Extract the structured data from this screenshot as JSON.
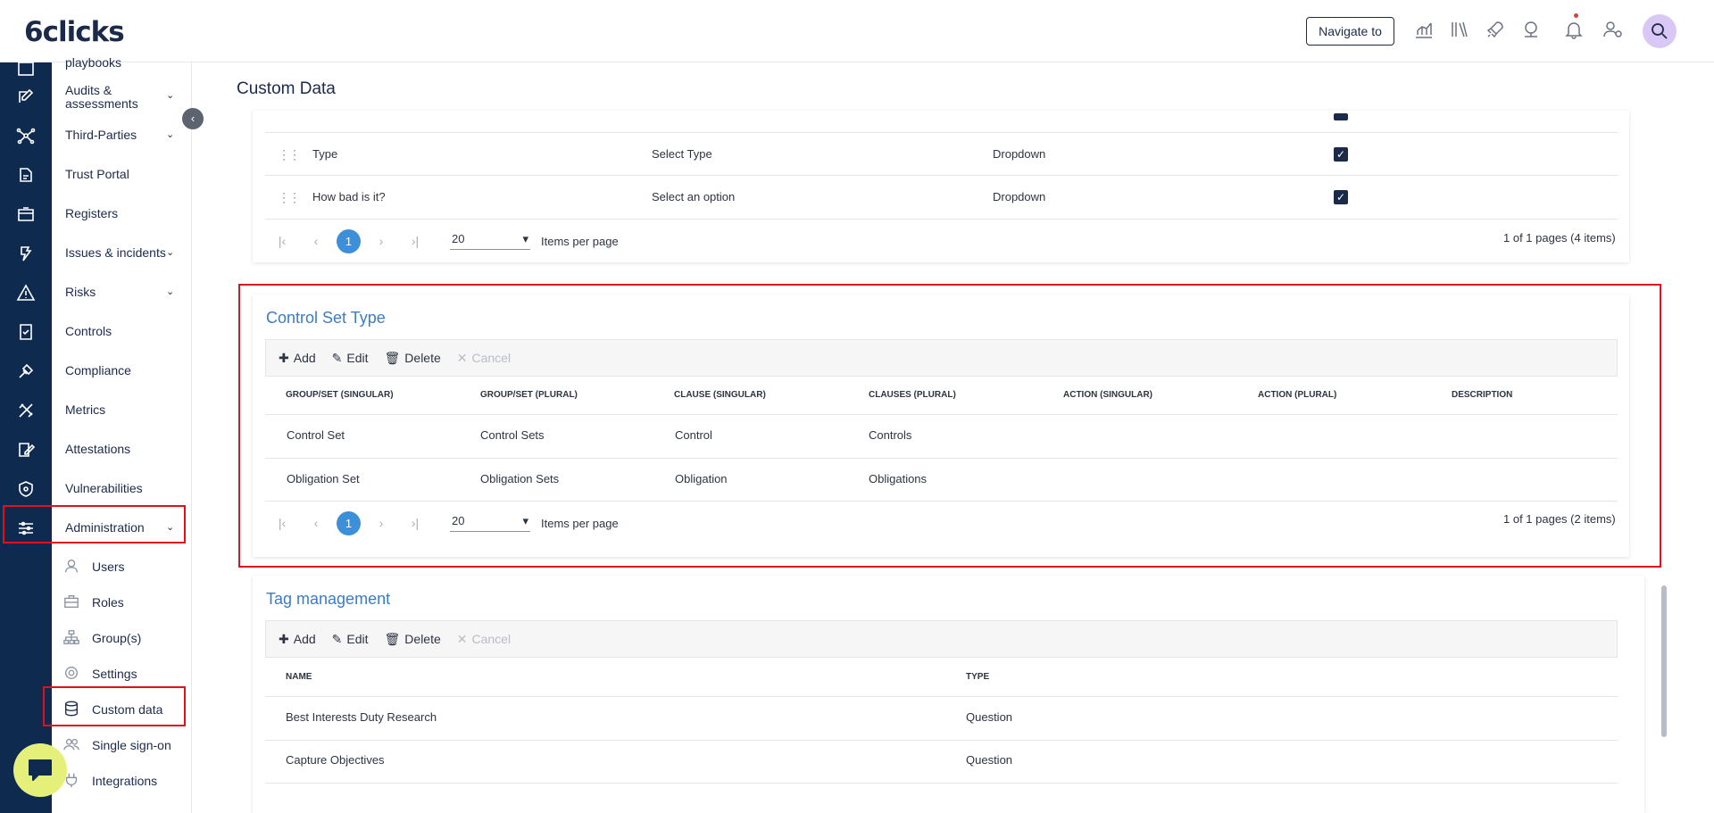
{
  "header": {
    "logo": "6clicks",
    "navigate_label": "Navigate to",
    "icons": [
      "analytics-icon",
      "library-icon",
      "rocket-icon",
      "support-icon",
      "bell-icon",
      "user-settings-icon",
      "global-search-icon"
    ]
  },
  "sidebar": {
    "items": [
      {
        "label": "playbooks"
      },
      {
        "label": "Audits &\nassessments",
        "expand": "⌄"
      },
      {
        "label": "Third-Parties",
        "expand": "⌄"
      },
      {
        "label": "Trust Portal"
      },
      {
        "label": "Registers"
      },
      {
        "label": "Issues & incidents",
        "expand": "⌄"
      },
      {
        "label": "Risks",
        "expand": "⌄"
      },
      {
        "label": "Controls"
      },
      {
        "label": "Compliance"
      },
      {
        "label": "Metrics"
      },
      {
        "label": "Attestations"
      },
      {
        "label": "Vulnerabilities"
      },
      {
        "label": "Administration",
        "expand": "⌄"
      }
    ],
    "subitems": [
      {
        "label": "Users"
      },
      {
        "label": "Roles"
      },
      {
        "label": "Group(s)"
      },
      {
        "label": "Settings"
      },
      {
        "label": "Custom data"
      },
      {
        "label": "Single sign-on"
      },
      {
        "label": "Integrations"
      }
    ]
  },
  "page": {
    "title": "Custom Data"
  },
  "custom_fields_card": {
    "rows": [
      {
        "name": "Type",
        "placeholder": "Select Type",
        "field_type": "Dropdown",
        "required": true
      },
      {
        "name": "How bad is it?",
        "placeholder": "Select an option",
        "field_type": "Dropdown",
        "required": true
      }
    ],
    "pager": {
      "page": "1",
      "per_page": "20",
      "per_page_label": "Items per page",
      "info": "1 of 1 pages (4 items)"
    }
  },
  "control_set_type": {
    "title": "Control Set Type",
    "toolbar": {
      "add": "Add",
      "edit": "Edit",
      "delete": "Delete",
      "cancel": "Cancel"
    },
    "columns": [
      "GROUP/SET (SINGULAR)",
      "GROUP/SET (PLURAL)",
      "CLAUSE (SINGULAR)",
      "CLAUSES (PLURAL)",
      "ACTION (SINGULAR)",
      "ACTION (PLURAL)",
      "DESCRIPTION"
    ],
    "rows": [
      [
        "Control Set",
        "Control Sets",
        "Control",
        "Controls",
        "",
        "",
        ""
      ],
      [
        "Obligation Set",
        "Obligation Sets",
        "Obligation",
        "Obligations",
        "",
        "",
        ""
      ]
    ],
    "pager": {
      "page": "1",
      "per_page": "20",
      "per_page_label": "Items per page",
      "info": "1 of 1 pages (2 items)"
    }
  },
  "tag_management": {
    "title": "Tag management",
    "toolbar": {
      "add": "Add",
      "edit": "Edit",
      "delete": "Delete",
      "cancel": "Cancel"
    },
    "columns": [
      "NAME",
      "TYPE"
    ],
    "rows": [
      [
        "Best Interests Duty Research",
        "Question"
      ],
      [
        "Capture Objectives",
        "Question"
      ]
    ]
  },
  "colors": {
    "rail": "#0e2a4f",
    "accent": "#3d8fd8",
    "title_blue": "#3b7cc4",
    "highlight": "#e0111b"
  }
}
